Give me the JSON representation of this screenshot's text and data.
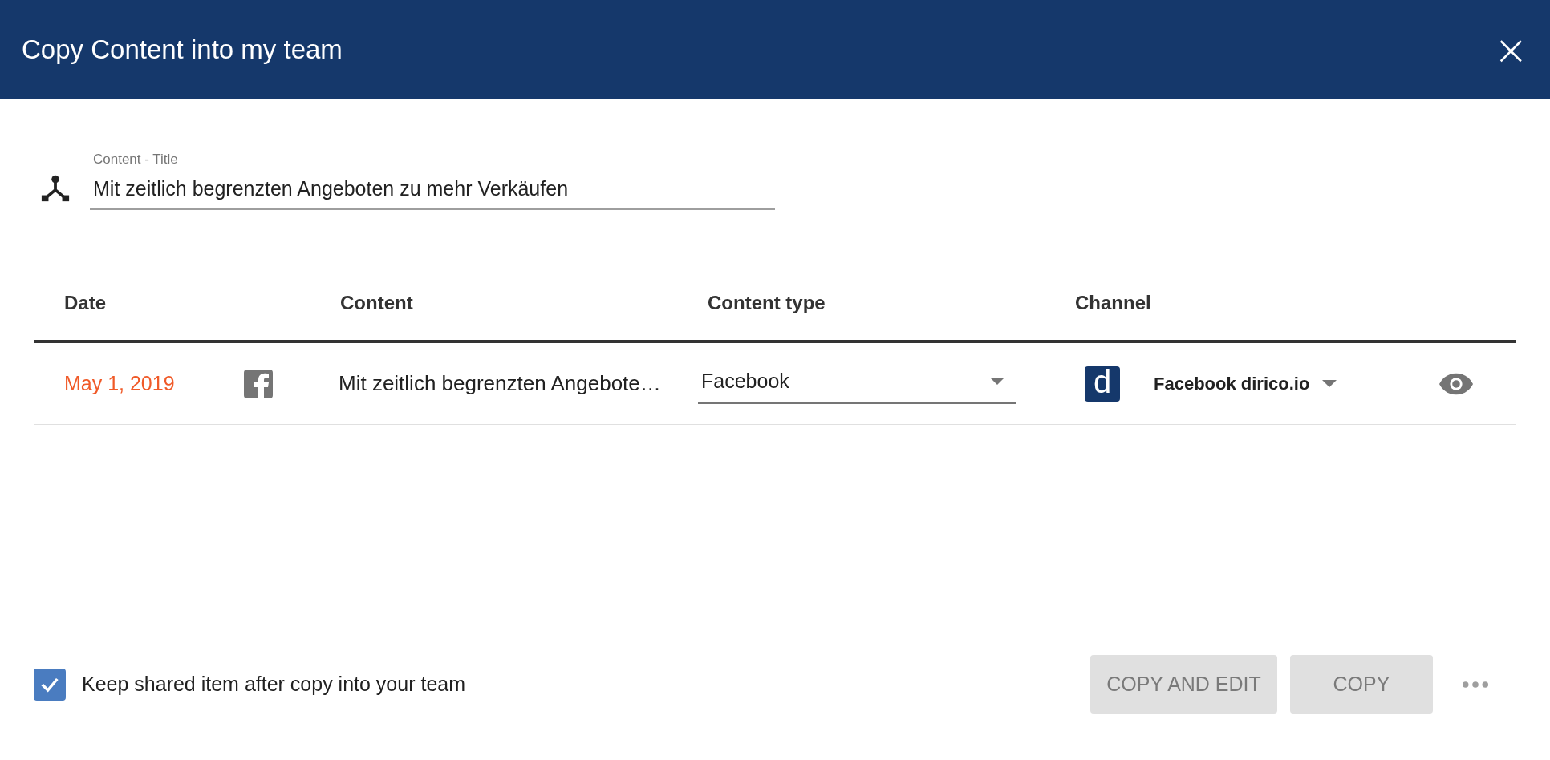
{
  "dialog": {
    "title": "Copy Content into my team",
    "close": "×"
  },
  "title_field": {
    "label": "Content - Title",
    "value": "Mit zeitlich begrenzten Angeboten zu mehr Verkäufen"
  },
  "table": {
    "columns": [
      "Date",
      "Content",
      "Content type",
      "Channel"
    ],
    "rows": [
      {
        "date": "May 1, 2019",
        "content": "Mit zeitlich begrenzten Angebote…",
        "content_type": "Facebook",
        "channel": "Facebook dirico.io",
        "logo_letter": "d"
      }
    ]
  },
  "keep_shared": {
    "label": "Keep shared item after copy into your team",
    "checked": true
  },
  "buttons": [
    {
      "label": "COPY AND EDIT",
      "disabled": true
    },
    {
      "label": "COPY",
      "disabled": true
    }
  ]
}
